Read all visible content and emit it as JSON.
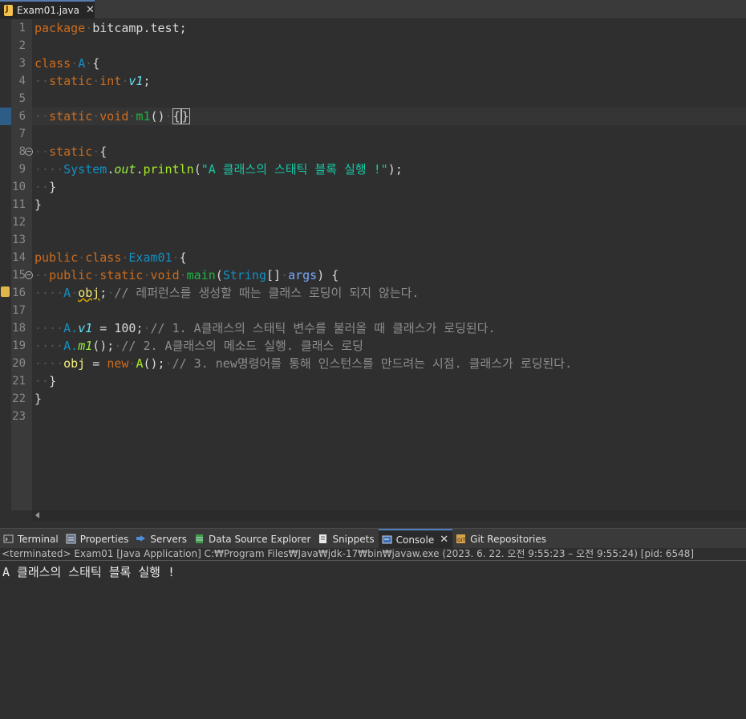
{
  "editor_tab": {
    "label": "Exam01.java",
    "close": "✕"
  },
  "lines": [
    {
      "n": "1"
    },
    {
      "n": "2"
    },
    {
      "n": "3"
    },
    {
      "n": "4"
    },
    {
      "n": "5"
    },
    {
      "n": "6"
    },
    {
      "n": "7"
    },
    {
      "n": "8"
    },
    {
      "n": "9"
    },
    {
      "n": "10"
    },
    {
      "n": "11"
    },
    {
      "n": "12"
    },
    {
      "n": "13"
    },
    {
      "n": "14"
    },
    {
      "n": "15"
    },
    {
      "n": "16"
    },
    {
      "n": "17"
    },
    {
      "n": "18"
    },
    {
      "n": "19"
    },
    {
      "n": "20"
    },
    {
      "n": "21"
    },
    {
      "n": "22"
    },
    {
      "n": "23"
    }
  ],
  "code": {
    "l1_kw": "package",
    "l1_rest": "bitcamp.test;",
    "l3_kw": "class",
    "l3_type": "A",
    "l3_rest": "{",
    "l4_kw1": "static",
    "l4_kw2": "int",
    "l4_field": "v1",
    "l4_rest": ";",
    "l6_kw1": "static",
    "l6_kw2": "void",
    "l6_method": "m1",
    "l6_rest": "()",
    "l6_open": "{",
    "l6_close": "}",
    "l8_kw": "static",
    "l8_rest": "{",
    "l9_type": "System",
    "l9_dot1": ".",
    "l9_static": "out",
    "l9_dot2": ".",
    "l9_call": "println",
    "l9_p1": "(",
    "l9_str": "\"A 클래스의 스태틱 블록 실행 !\"",
    "l9_p2": ");",
    "l10": "}",
    "l11": "}",
    "l14_kw1": "public",
    "l14_kw2": "class",
    "l14_type": "Exam01",
    "l14_rest": "{",
    "l15_kw1": "public",
    "l15_kw2": "static",
    "l15_kw3": "void",
    "l15_method": "main",
    "l15_p1": "(",
    "l15_type": "String",
    "l15_arr": "[]",
    "l15_args": "args",
    "l15_p2": ") {",
    "l16_type": "A",
    "l16_var": "obj",
    "l16_semi": ";",
    "l16_cmt": "// 레퍼런스를 생성할 때는 클래스 로딩이 되지 않는다.",
    "l18_a": "A.",
    "l18_field": "v1",
    "l18_eq": " = ",
    "l18_num": "100",
    "l18_semi": ";",
    "l18_cmt": "// 1. A클래스의 스태틱 변수를 불러올 때 클래스가 로딩된다.",
    "l19_a": "A.",
    "l19_call": "m1",
    "l19_rest": "();",
    "l19_cmt": "// 2. A클래스의 메소드 실행. 클래스 로딩",
    "l20_var": "obj",
    "l20_eq": " = ",
    "l20_kw": "new",
    "l20_call": "A",
    "l20_rest": "();",
    "l20_cmt": "// 3. new명령어를 통해 인스턴스를 만드려는 시점. 클래스가 로딩된다.",
    "l21": "}",
    "l22": "}"
  },
  "views": {
    "terminal": "Terminal",
    "properties": "Properties",
    "servers": "Servers",
    "datasource": "Data Source Explorer",
    "snippets": "Snippets",
    "console": "Console",
    "console_close": "✕",
    "git": "Git Repositories"
  },
  "console": {
    "info": "<terminated> Exam01 [Java Application] C:₩Program Files₩Java₩jdk-17₩bin₩javaw.exe  (2023. 6. 22. 오전 9:55:23 – 오전 9:55:24) [pid: 6548]",
    "output": "A 클래스의 스태틱 블록 실행 !"
  },
  "colors": {
    "keyword": "#cc6c1d",
    "type": "#1290c3",
    "string": "#17c6a3",
    "comment": "#8d8d8d",
    "active_tab_accent": "#4d7fc1"
  }
}
